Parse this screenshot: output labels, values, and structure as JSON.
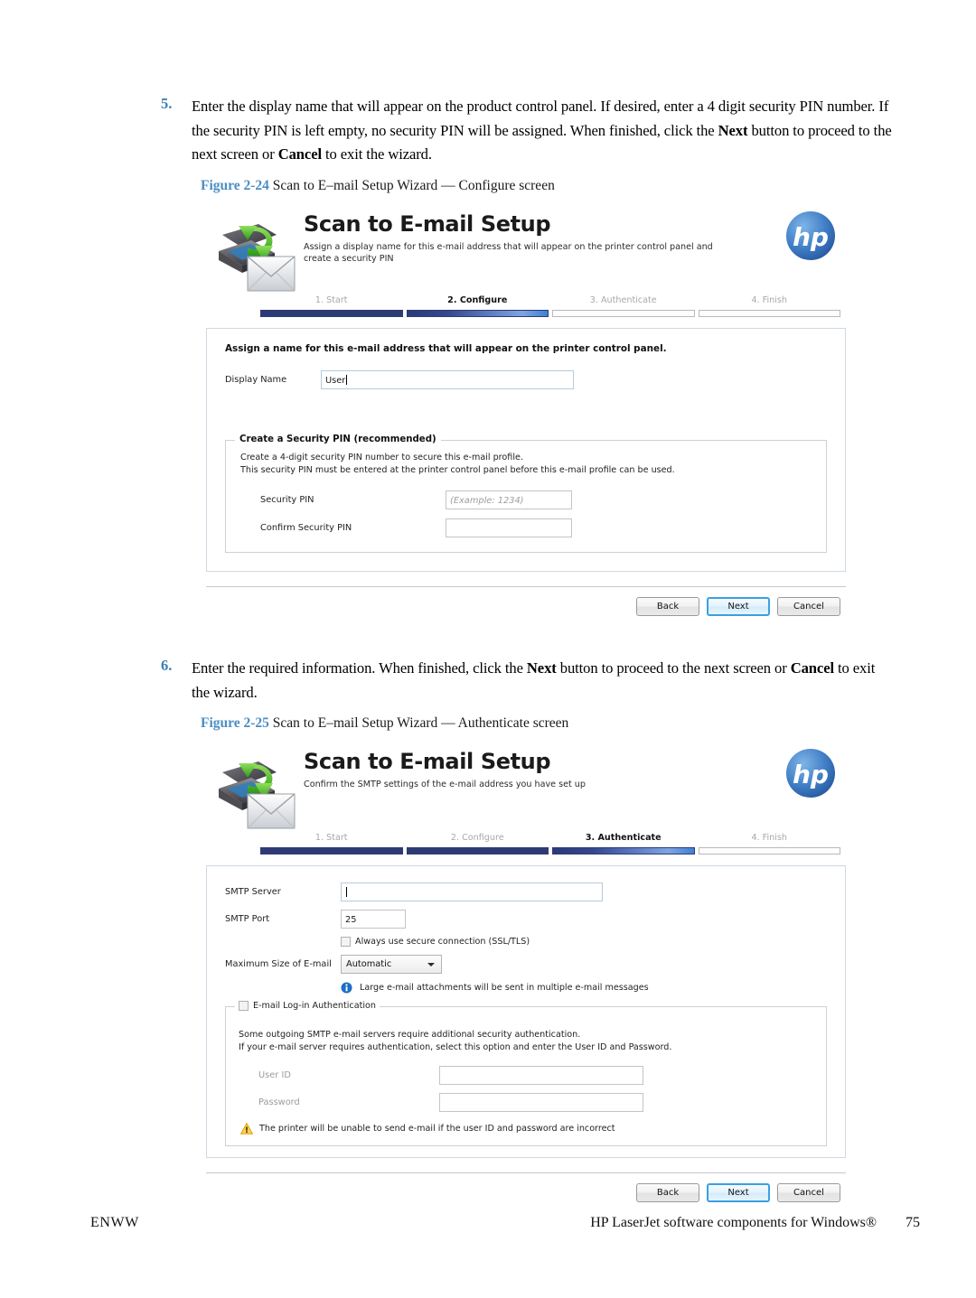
{
  "page": {
    "footer_left": "ENWW",
    "footer_right": "HP LaserJet software components for Windows®",
    "page_number": "75",
    "accent_blue": "#4b8ec4",
    "step_number_color": "#3d7fb5"
  },
  "steps": [
    {
      "number": "5.",
      "segments": [
        {
          "text": "Enter the display name that will appear on the product control panel. If desired, enter a 4 digit security PIN number. If the security PIN is left empty, no security PIN will be assigned. When finished, click the ",
          "bold": false
        },
        {
          "text": "Next",
          "bold": true
        },
        {
          "text": " button to proceed to the next screen or ",
          "bold": false
        },
        {
          "text": "Cancel",
          "bold": true
        },
        {
          "text": " to exit the wizard.",
          "bold": false
        }
      ]
    },
    {
      "number": "6.",
      "segments": [
        {
          "text": "Enter the required information. When finished, click the ",
          "bold": false
        },
        {
          "text": "Next",
          "bold": true
        },
        {
          "text": " button to proceed to the next screen or ",
          "bold": false
        },
        {
          "text": "Cancel",
          "bold": true
        },
        {
          "text": " to exit the wizard.",
          "bold": false
        }
      ]
    }
  ],
  "figures": [
    {
      "label": "Figure 2-24",
      "title": "Scan to E–mail Setup Wizard — Configure screen"
    },
    {
      "label": "Figure 2-25",
      "title": "Scan to E–mail Setup Wizard — Authenticate screen"
    }
  ],
  "wizard_configure": {
    "title": "Scan to E-mail Setup",
    "subtitle": "Assign a display name for this e-mail address that will appear on the printer control panel and create a security PIN",
    "logo_alt": "hp",
    "steps": [
      {
        "label": "1. Start",
        "state": "done"
      },
      {
        "label": "2. Configure",
        "state": "active"
      },
      {
        "label": "3. Authenticate",
        "state": "todo"
      },
      {
        "label": "4. Finish",
        "state": "todo"
      }
    ],
    "panel_heading": "Assign a name for this e-mail address that will appear on the printer control panel.",
    "display_name_label": "Display Name",
    "display_name_value": "User",
    "pin_group_title": "Create a Security PIN (recommended)",
    "pin_group_desc_line1": "Create a 4-digit security PIN number to secure this e-mail profile.",
    "pin_group_desc_line2": "This security PIN must be entered at the printer control panel before this e-mail profile can be used.",
    "security_pin_label": "Security PIN",
    "security_pin_placeholder": "(Example: 1234)",
    "confirm_pin_label": "Confirm Security PIN",
    "confirm_pin_value": "",
    "buttons": {
      "back": "Back",
      "next": "Next",
      "cancel": "Cancel"
    }
  },
  "wizard_authenticate": {
    "title": "Scan to E-mail Setup",
    "subtitle": "Confirm the SMTP settings of the e-mail address you have set up",
    "logo_alt": "hp",
    "steps": [
      {
        "label": "1. Start",
        "state": "done"
      },
      {
        "label": "2. Configure",
        "state": "done"
      },
      {
        "label": "3. Authenticate",
        "state": "active"
      },
      {
        "label": "4. Finish",
        "state": "todo"
      }
    ],
    "smtp_server_label": "SMTP Server",
    "smtp_server_value": "",
    "smtp_port_label": "SMTP Port",
    "smtp_port_value": "25",
    "ssl_checkbox_label": "Always use secure connection (SSL/TLS)",
    "ssl_checked": false,
    "max_size_label": "Maximum Size of E-mail",
    "max_size_value": "Automatic",
    "info_note": "Large e-mail attachments will be sent in multiple e-mail messages",
    "auth_checkbox_label": "E-mail Log-in Authentication",
    "auth_checked": false,
    "auth_desc_line1": "Some outgoing SMTP e-mail servers require additional security authentication.",
    "auth_desc_line2": "If your e-mail server requires authentication, select this option and enter the User ID and Password.",
    "user_id_label": "User ID",
    "user_id_value": "",
    "password_label": "Password",
    "password_value": "",
    "warning_note": "The printer will be unable to send e-mail if the user ID and password are incorrect",
    "buttons": {
      "back": "Back",
      "next": "Next",
      "cancel": "Cancel"
    }
  }
}
